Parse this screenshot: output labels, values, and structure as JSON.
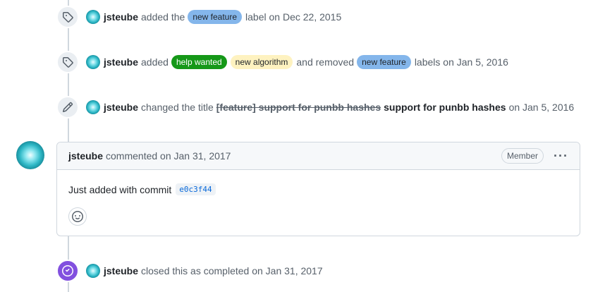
{
  "user": {
    "name": "jsteube"
  },
  "events": {
    "label_added": {
      "verb": "added the",
      "label": {
        "text": "new feature",
        "bg": "#84b6eb",
        "fg": "#1f2328"
      },
      "suffix": "label on Dec 22, 2015"
    },
    "labels_changed": {
      "verb": "added",
      "added_labels": [
        {
          "text": "help wanted",
          "bg": "#159818",
          "fg": "#ffffff"
        },
        {
          "text": "new algorithm",
          "bg": "#fef2c0",
          "fg": "#1f2328"
        }
      ],
      "middle": "and removed",
      "removed_labels": [
        {
          "text": "new feature",
          "bg": "#84b6eb",
          "fg": "#1f2328"
        }
      ],
      "suffix": "labels on Jan 5, 2016"
    },
    "title_changed": {
      "verb": "changed the title",
      "old_title": "[feature] support for punbb hashes",
      "new_title": "support for punbb hashes",
      "suffix": "on Jan 5, 2016"
    },
    "closed": {
      "text": "closed this as completed on Jan 31, 2017",
      "accent": "#8250df"
    }
  },
  "comment": {
    "meta": "commented on Jan 31, 2017",
    "role": "Member",
    "menu_glyph": "···",
    "body": "Just added with commit",
    "commit": "e0c3f44"
  },
  "icons": {
    "label": "tag-icon",
    "title_edit": "pencil-icon",
    "closed": "check-circle-icon",
    "reaction": "smiley-icon"
  }
}
